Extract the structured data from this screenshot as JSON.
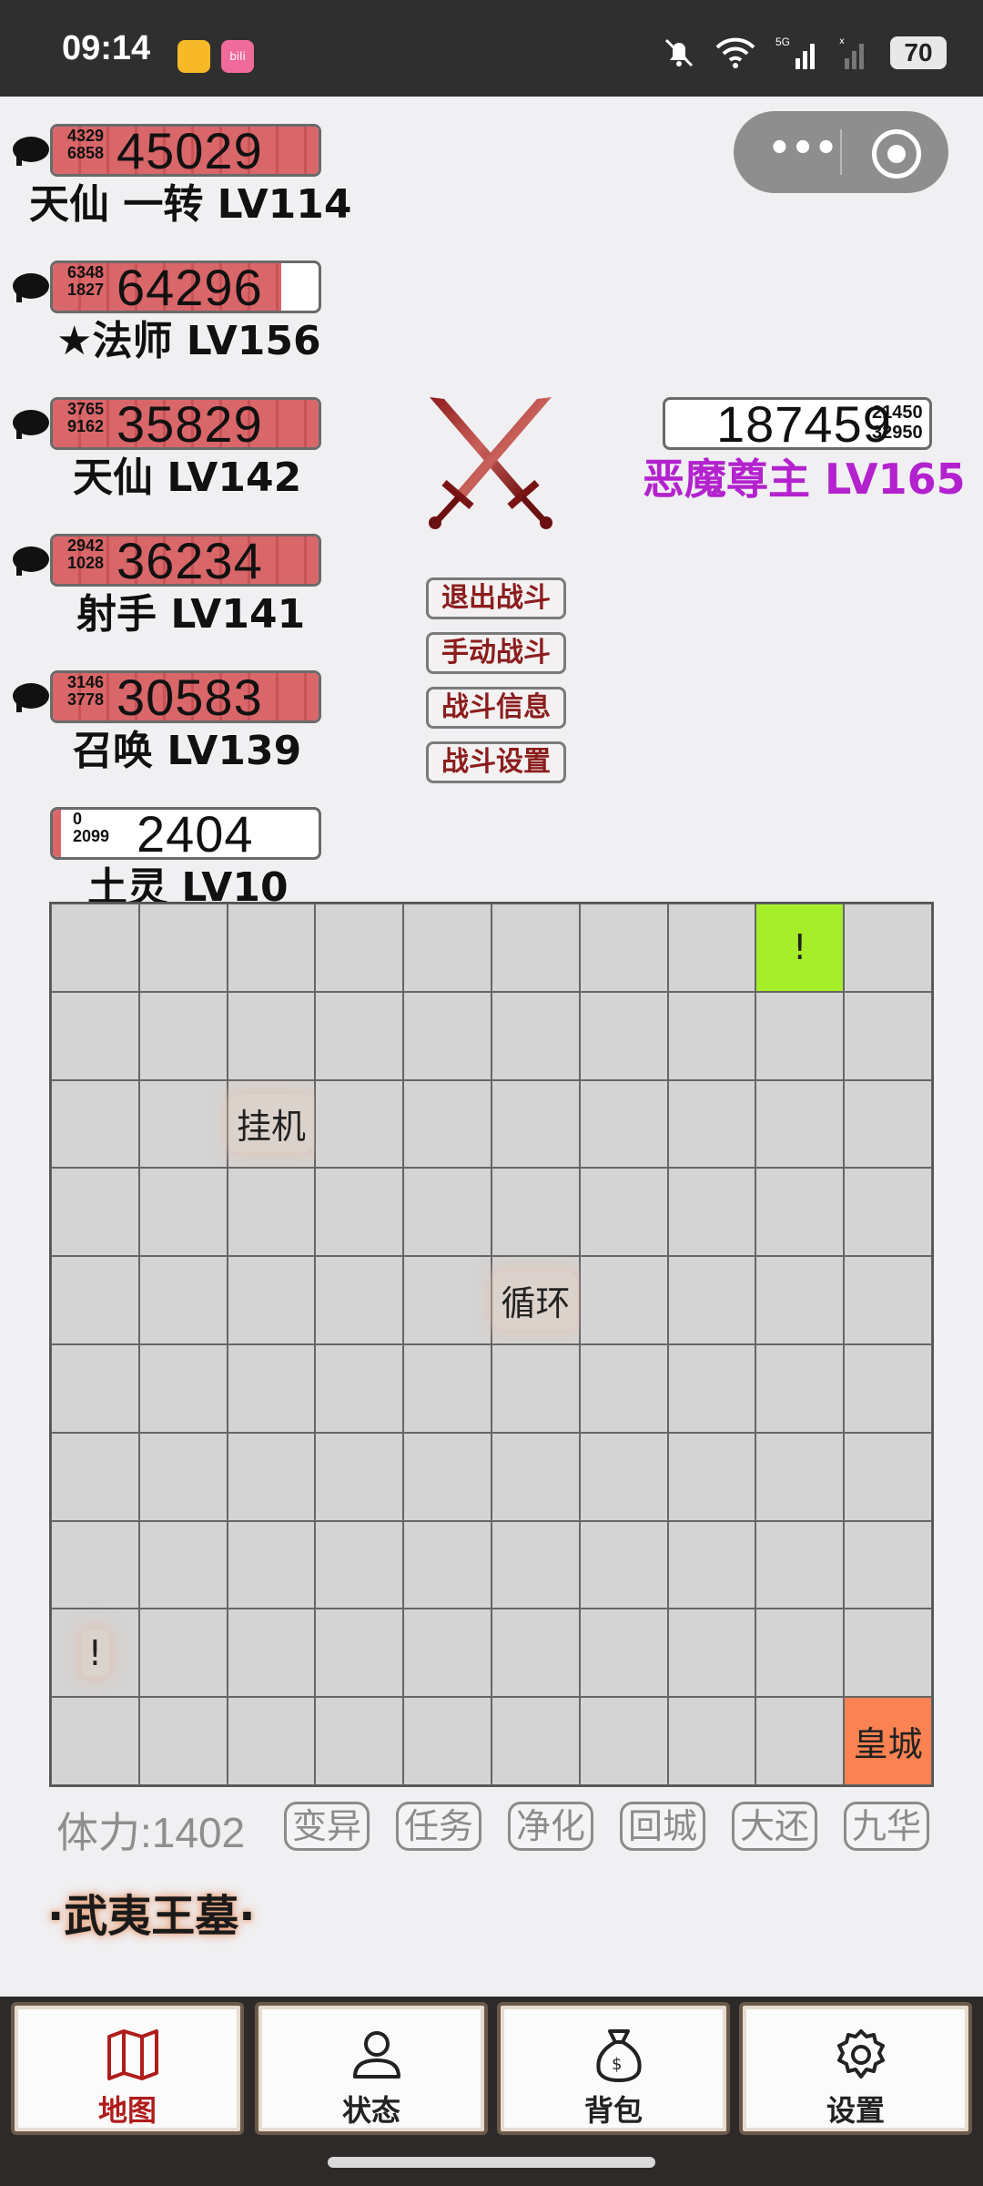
{
  "status_bar": {
    "time": "09:14",
    "battery": "70",
    "network": "5G"
  },
  "capsule": {
    "more": "•••"
  },
  "party": [
    {
      "stat1": "4329",
      "stat2": "6858",
      "hp": "45029",
      "hp_fraction": 1.0,
      "name": "天仙 一转 LV114"
    },
    {
      "stat1": "6348",
      "stat2": "1827",
      "hp": "64296",
      "hp_fraction": 0.86,
      "name": "★法师 LV156"
    },
    {
      "stat1": "3765",
      "stat2": "9162",
      "hp": "35829",
      "hp_fraction": 1.0,
      "name": "天仙 LV142"
    },
    {
      "stat1": "2942",
      "stat2": "1028",
      "hp": "36234",
      "hp_fraction": 1.0,
      "name": "射手 LV141"
    },
    {
      "stat1": "3146",
      "stat2": "3778",
      "hp": "30583",
      "hp_fraction": 1.0,
      "name": "召唤 LV139"
    },
    {
      "stat1": "0",
      "stat2": "2099",
      "hp": "2404",
      "hp_fraction": 0.03,
      "name": "土灵 LV10"
    }
  ],
  "enemy": {
    "hp": "187459",
    "stat1": "21450",
    "stat2": "32950",
    "name": "恶魔尊主 LV165"
  },
  "battle_buttons": {
    "exit": "退出战斗",
    "manual": "手动战斗",
    "info": "战斗信息",
    "settings": "战斗设置"
  },
  "grid": {
    "marker_top": "!",
    "idle": "挂机",
    "loop": "循环",
    "marker_left": "!",
    "castle": "皇城"
  },
  "stamina": "体力:1402",
  "actions": [
    "变异",
    "任务",
    "净化",
    "回城",
    "大还",
    "九华"
  ],
  "map_name": "·武夷王墓·",
  "nav": {
    "map": "地图",
    "status": "状态",
    "bag": "背包",
    "settings": "设置"
  },
  "colors": {
    "accent": "#b01c1c",
    "enemy_name": "#b322ce",
    "hp_fill": "#d9676a",
    "tile_green": "#a6ee2a",
    "tile_orange": "#fb8252"
  }
}
